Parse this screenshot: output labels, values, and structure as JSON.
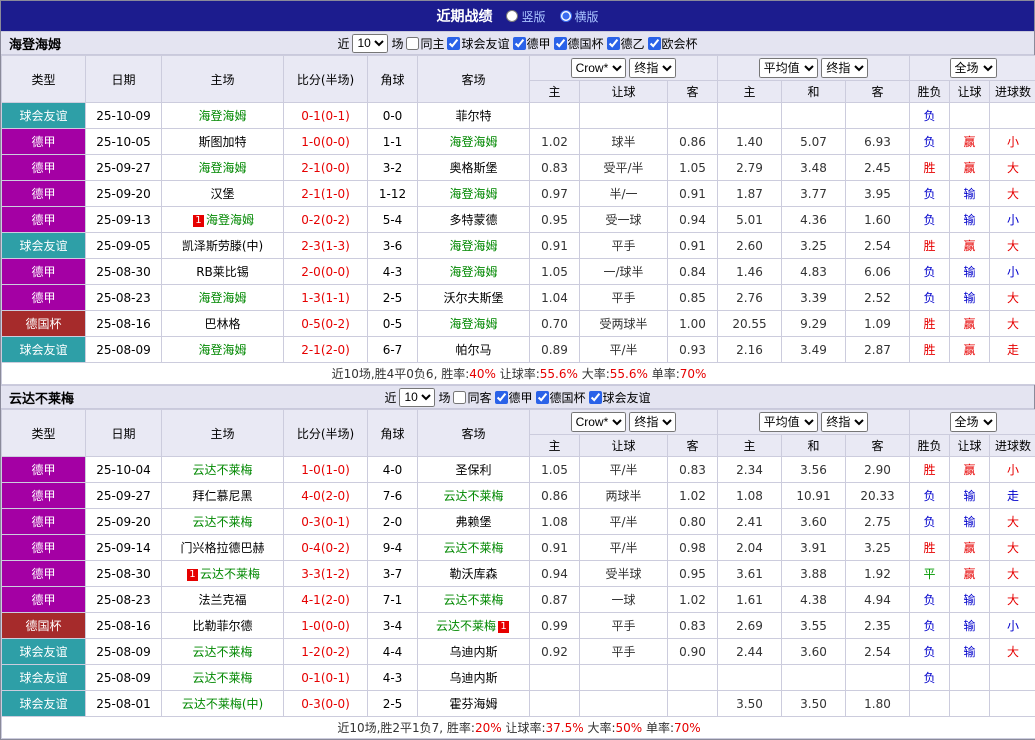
{
  "title_bar": {
    "title": "近期战绩",
    "vertical_label": "竖版",
    "horizontal_label": "横版"
  },
  "league_colors": {
    "球会友谊": "#2e9fa7",
    "德甲": "#a400a4",
    "德国杯": "#a62b2b"
  },
  "result_colors": {
    "red": "#e60000",
    "blue": "#0000cc",
    "green": "#009900"
  },
  "tables": [
    {
      "team": "海登海姆",
      "filter": {
        "near_label": "近",
        "near_value": "10",
        "games_label": "场",
        "checkboxes": [
          {
            "label": "同主",
            "checked": false
          },
          {
            "label": "球会友谊",
            "checked": true
          },
          {
            "label": "德甲",
            "checked": true
          },
          {
            "label": "德国杯",
            "checked": true
          },
          {
            "label": "德乙",
            "checked": true
          },
          {
            "label": "欧会杯",
            "checked": true
          }
        ]
      },
      "header": {
        "cols": [
          "类型",
          "日期",
          "主场",
          "比分(半场)",
          "角球",
          "客场"
        ],
        "dropdowns": [
          [
            "Crow*",
            "终指"
          ],
          [
            "平均值",
            "终指"
          ],
          [
            "全场"
          ]
        ],
        "sub": [
          "主",
          "让球",
          "客",
          "主",
          "和",
          "客",
          "胜负",
          "让球",
          "进球数"
        ]
      },
      "rows": [
        {
          "type": "球会友谊",
          "date": "25-10-09",
          "home": "海登海姆",
          "home_tracked": true,
          "score": "0-1(0-1)",
          "corner": "0-0",
          "away": "菲尔特",
          "ah": [
            "",
            "",
            ""
          ],
          "eu": [
            "",
            "",
            ""
          ],
          "res": [
            {
              "t": "负",
              "c": "blue"
            },
            null,
            null
          ]
        },
        {
          "type": "德甲",
          "date": "25-10-05",
          "home": "斯图加特",
          "score": "1-0(0-0)",
          "corner": "1-1",
          "away": "海登海姆",
          "away_tracked": true,
          "ah": [
            "1.02",
            "球半",
            "0.86"
          ],
          "eu": [
            "1.40",
            "5.07",
            "6.93"
          ],
          "res": [
            {
              "t": "负",
              "c": "blue"
            },
            {
              "t": "赢",
              "c": "red"
            },
            {
              "t": "小",
              "c": "red"
            }
          ]
        },
        {
          "type": "德甲",
          "date": "25-09-27",
          "home": "海登海姆",
          "home_tracked": true,
          "score": "2-1(0-0)",
          "corner": "3-2",
          "away": "奥格斯堡",
          "ah": [
            "0.83",
            "受平/半",
            "1.05"
          ],
          "eu": [
            "2.79",
            "3.48",
            "2.45"
          ],
          "res": [
            {
              "t": "胜",
              "c": "red"
            },
            {
              "t": "赢",
              "c": "red"
            },
            {
              "t": "大",
              "c": "red"
            }
          ]
        },
        {
          "type": "德甲",
          "date": "25-09-20",
          "home": "汉堡",
          "score": "2-1(1-0)",
          "corner": "1-12",
          "away": "海登海姆",
          "away_tracked": true,
          "ah": [
            "0.97",
            "半/一",
            "0.91"
          ],
          "eu": [
            "1.87",
            "3.77",
            "3.95"
          ],
          "res": [
            {
              "t": "负",
              "c": "blue"
            },
            {
              "t": "输",
              "c": "blue"
            },
            {
              "t": "大",
              "c": "red"
            }
          ]
        },
        {
          "type": "德甲",
          "date": "25-09-13",
          "home": "海登海姆",
          "home_tracked": true,
          "home_badge": "1",
          "score": "0-2(0-2)",
          "corner": "5-4",
          "away": "多特蒙德",
          "ah": [
            "0.95",
            "受一球",
            "0.94"
          ],
          "eu": [
            "5.01",
            "4.36",
            "1.60"
          ],
          "res": [
            {
              "t": "负",
              "c": "blue"
            },
            {
              "t": "输",
              "c": "blue"
            },
            {
              "t": "小",
              "c": "blue"
            }
          ]
        },
        {
          "type": "球会友谊",
          "date": "25-09-05",
          "home": "凯泽斯劳滕(中)",
          "score": "2-3(1-3)",
          "corner": "3-6",
          "away": "海登海姆",
          "away_tracked": true,
          "ah": [
            "0.91",
            "平手",
            "0.91"
          ],
          "eu": [
            "2.60",
            "3.25",
            "2.54"
          ],
          "res": [
            {
              "t": "胜",
              "c": "red"
            },
            {
              "t": "赢",
              "c": "red"
            },
            {
              "t": "大",
              "c": "red"
            }
          ]
        },
        {
          "type": "德甲",
          "date": "25-08-30",
          "home": "RB莱比锡",
          "score": "2-0(0-0)",
          "corner": "4-3",
          "away": "海登海姆",
          "away_tracked": true,
          "ah": [
            "1.05",
            "一/球半",
            "0.84"
          ],
          "eu": [
            "1.46",
            "4.83",
            "6.06"
          ],
          "res": [
            {
              "t": "负",
              "c": "blue"
            },
            {
              "t": "输",
              "c": "blue"
            },
            {
              "t": "小",
              "c": "blue"
            }
          ]
        },
        {
          "type": "德甲",
          "date": "25-08-23",
          "home": "海登海姆",
          "home_tracked": true,
          "score": "1-3(1-1)",
          "corner": "2-5",
          "away": "沃尔夫斯堡",
          "ah": [
            "1.04",
            "平手",
            "0.85"
          ],
          "eu": [
            "2.76",
            "3.39",
            "2.52"
          ],
          "res": [
            {
              "t": "负",
              "c": "blue"
            },
            {
              "t": "输",
              "c": "blue"
            },
            {
              "t": "大",
              "c": "red"
            }
          ]
        },
        {
          "type": "德国杯",
          "date": "25-08-16",
          "home": "巴林格",
          "score": "0-5(0-2)",
          "corner": "0-5",
          "away": "海登海姆",
          "away_tracked": true,
          "ah": [
            "0.70",
            "受两球半",
            "1.00"
          ],
          "eu": [
            "20.55",
            "9.29",
            "1.09"
          ],
          "res": [
            {
              "t": "胜",
              "c": "red"
            },
            {
              "t": "赢",
              "c": "red"
            },
            {
              "t": "大",
              "c": "red"
            }
          ]
        },
        {
          "type": "球会友谊",
          "date": "25-08-09",
          "home": "海登海姆",
          "home_tracked": true,
          "score": "2-1(2-0)",
          "corner": "6-7",
          "away": "帕尔马",
          "ah": [
            "0.89",
            "平/半",
            "0.93"
          ],
          "eu": [
            "2.16",
            "3.49",
            "2.87"
          ],
          "res": [
            {
              "t": "胜",
              "c": "red"
            },
            {
              "t": "赢",
              "c": "red"
            },
            {
              "t": "走",
              "c": "red"
            }
          ]
        }
      ],
      "summary": [
        {
          "t": "近10场,胜4平0负6, 胜率:",
          "c": "k"
        },
        {
          "t": "40%",
          "c": "r"
        },
        {
          "t": " 让球率:",
          "c": "k"
        },
        {
          "t": "55.6%",
          "c": "r"
        },
        {
          "t": " 大率:",
          "c": "k"
        },
        {
          "t": "55.6%",
          "c": "r"
        },
        {
          "t": " 单率:",
          "c": "k"
        },
        {
          "t": "70%",
          "c": "r"
        }
      ]
    },
    {
      "team": "云达不莱梅",
      "filter": {
        "near_label": "近",
        "near_value": "10",
        "games_label": "场",
        "checkboxes": [
          {
            "label": "同客",
            "checked": false
          },
          {
            "label": "德甲",
            "checked": true
          },
          {
            "label": "德国杯",
            "checked": true
          },
          {
            "label": "球会友谊",
            "checked": true
          }
        ]
      },
      "header": {
        "cols": [
          "类型",
          "日期",
          "主场",
          "比分(半场)",
          "角球",
          "客场"
        ],
        "dropdowns": [
          [
            "Crow*",
            "终指"
          ],
          [
            "平均值",
            "终指"
          ],
          [
            "全场"
          ]
        ],
        "sub": [
          "主",
          "让球",
          "客",
          "主",
          "和",
          "客",
          "胜负",
          "让球",
          "进球数"
        ]
      },
      "rows": [
        {
          "type": "德甲",
          "date": "25-10-04",
          "home": "云达不莱梅",
          "home_tracked": true,
          "score": "1-0(1-0)",
          "corner": "4-0",
          "away": "圣保利",
          "ah": [
            "1.05",
            "平/半",
            "0.83"
          ],
          "eu": [
            "2.34",
            "3.56",
            "2.90"
          ],
          "res": [
            {
              "t": "胜",
              "c": "red"
            },
            {
              "t": "赢",
              "c": "red"
            },
            {
              "t": "小",
              "c": "red"
            }
          ]
        },
        {
          "type": "德甲",
          "date": "25-09-27",
          "home": "拜仁慕尼黑",
          "score": "4-0(2-0)",
          "corner": "7-6",
          "away": "云达不莱梅",
          "away_tracked": true,
          "ah": [
            "0.86",
            "两球半",
            "1.02"
          ],
          "eu": [
            "1.08",
            "10.91",
            "20.33"
          ],
          "res": [
            {
              "t": "负",
              "c": "blue"
            },
            {
              "t": "输",
              "c": "blue"
            },
            {
              "t": "走",
              "c": "blue"
            }
          ]
        },
        {
          "type": "德甲",
          "date": "25-09-20",
          "home": "云达不莱梅",
          "home_tracked": true,
          "score": "0-3(0-1)",
          "corner": "2-0",
          "away": "弗赖堡",
          "ah": [
            "1.08",
            "平/半",
            "0.80"
          ],
          "eu": [
            "2.41",
            "3.60",
            "2.75"
          ],
          "res": [
            {
              "t": "负",
              "c": "blue"
            },
            {
              "t": "输",
              "c": "blue"
            },
            {
              "t": "大",
              "c": "red"
            }
          ]
        },
        {
          "type": "德甲",
          "date": "25-09-14",
          "home": "门兴格拉德巴赫",
          "score": "0-4(0-2)",
          "corner": "9-4",
          "away": "云达不莱梅",
          "away_tracked": true,
          "ah": [
            "0.91",
            "平/半",
            "0.98"
          ],
          "eu": [
            "2.04",
            "3.91",
            "3.25"
          ],
          "res": [
            {
              "t": "胜",
              "c": "red"
            },
            {
              "t": "赢",
              "c": "red"
            },
            {
              "t": "大",
              "c": "red"
            }
          ]
        },
        {
          "type": "德甲",
          "date": "25-08-30",
          "home": "云达不莱梅",
          "home_tracked": true,
          "home_badge": "1",
          "score": "3-3(1-2)",
          "corner": "3-7",
          "away": "勒沃库森",
          "ah": [
            "0.94",
            "受半球",
            "0.95"
          ],
          "eu": [
            "3.61",
            "3.88",
            "1.92"
          ],
          "res": [
            {
              "t": "平",
              "c": "green"
            },
            {
              "t": "赢",
              "c": "red"
            },
            {
              "t": "大",
              "c": "red"
            }
          ]
        },
        {
          "type": "德甲",
          "date": "25-08-23",
          "home": "法兰克福",
          "score": "4-1(2-0)",
          "corner": "7-1",
          "away": "云达不莱梅",
          "away_tracked": true,
          "ah": [
            "0.87",
            "一球",
            "1.02"
          ],
          "eu": [
            "1.61",
            "4.38",
            "4.94"
          ],
          "res": [
            {
              "t": "负",
              "c": "blue"
            },
            {
              "t": "输",
              "c": "blue"
            },
            {
              "t": "大",
              "c": "red"
            }
          ]
        },
        {
          "type": "德国杯",
          "date": "25-08-16",
          "home": "比勒菲尔德",
          "score": "1-0(0-0)",
          "corner": "3-4",
          "away": "云达不莱梅",
          "away_tracked": true,
          "away_badge": "1",
          "ah": [
            "0.99",
            "平手",
            "0.83"
          ],
          "eu": [
            "2.69",
            "3.55",
            "2.35"
          ],
          "res": [
            {
              "t": "负",
              "c": "blue"
            },
            {
              "t": "输",
              "c": "blue"
            },
            {
              "t": "小",
              "c": "blue"
            }
          ]
        },
        {
          "type": "球会友谊",
          "date": "25-08-09",
          "home": "云达不莱梅",
          "home_tracked": true,
          "score": "1-2(0-2)",
          "corner": "4-4",
          "away": "乌迪内斯",
          "ah": [
            "0.92",
            "平手",
            "0.90"
          ],
          "eu": [
            "2.44",
            "3.60",
            "2.54"
          ],
          "res": [
            {
              "t": "负",
              "c": "blue"
            },
            {
              "t": "输",
              "c": "blue"
            },
            {
              "t": "大",
              "c": "red"
            }
          ]
        },
        {
          "type": "球会友谊",
          "date": "25-08-09",
          "home": "云达不莱梅",
          "home_tracked": true,
          "score": "0-1(0-1)",
          "corner": "4-3",
          "away": "乌迪内斯",
          "ah": [
            "",
            "",
            ""
          ],
          "eu": [
            "",
            "",
            ""
          ],
          "res": [
            {
              "t": "负",
              "c": "blue"
            },
            null,
            null
          ]
        },
        {
          "type": "球会友谊",
          "date": "25-08-01",
          "home": "云达不莱梅(中)",
          "home_tracked": true,
          "score": "0-3(0-0)",
          "corner": "2-5",
          "away": "霍芬海姆",
          "ah": [
            "",
            "",
            ""
          ],
          "eu": [
            "3.50",
            "3.50",
            "1.80"
          ],
          "res": [
            null,
            null,
            null
          ]
        }
      ],
      "summary": [
        {
          "t": "近10场,胜2平1负7, 胜率:",
          "c": "k"
        },
        {
          "t": "20%",
          "c": "r"
        },
        {
          "t": " 让球率:",
          "c": "k"
        },
        {
          "t": "37.5%",
          "c": "r"
        },
        {
          "t": " 大率:",
          "c": "k"
        },
        {
          "t": "50%",
          "c": "r"
        },
        {
          "t": " 单率:",
          "c": "k"
        },
        {
          "t": "70%",
          "c": "r"
        }
      ]
    }
  ]
}
